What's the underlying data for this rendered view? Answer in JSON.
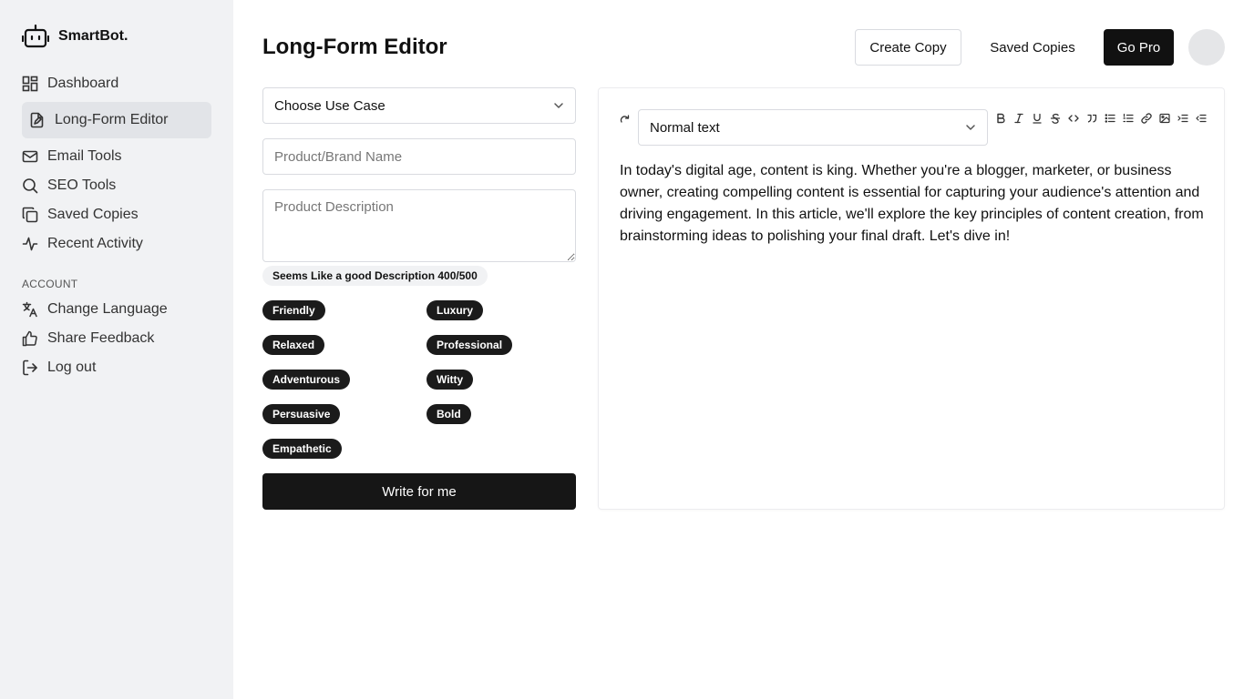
{
  "brand": {
    "name": "SmartBot."
  },
  "sidebar": {
    "items": [
      {
        "label": "Dashboard"
      },
      {
        "label": "Long-Form Editor"
      },
      {
        "label": "Email Tools"
      },
      {
        "label": "SEO Tools"
      },
      {
        "label": "Saved Copies"
      },
      {
        "label": "Recent Activity"
      }
    ],
    "account_title": "ACCOUNT",
    "account_items": [
      {
        "label": "Change Language"
      },
      {
        "label": "Share Feedback"
      },
      {
        "label": "Log out"
      }
    ]
  },
  "header": {
    "title": "Long-Form Editor",
    "create_copy": "Create Copy",
    "saved_copies": "Saved Copies",
    "go_pro": "Go Pro"
  },
  "form": {
    "use_case": "Choose Use Case",
    "brand_placeholder": "Product/Brand Name",
    "description_placeholder": "Product Description",
    "hint": "Seems Like a good Description 400/500",
    "tones": [
      "Friendly",
      "Luxury",
      "Relaxed",
      "Professional",
      "Adventurous",
      "Witty",
      "Persuasive",
      "Bold",
      "Empathetic"
    ],
    "submit": "Write for me"
  },
  "editor": {
    "block_type": "Normal text",
    "content": "In today's digital age, content is king. Whether you're a blogger, marketer, or business owner, creating compelling content is essential for capturing your audience's attention and driving engagement. In this article, we'll explore the key principles of content creation, from brainstorming ideas to polishing your final draft. Let's dive in!"
  },
  "colors": {
    "accent": "#111111",
    "sidebar_bg": "#f1f2f4",
    "active_bg": "#e2e4e8"
  }
}
